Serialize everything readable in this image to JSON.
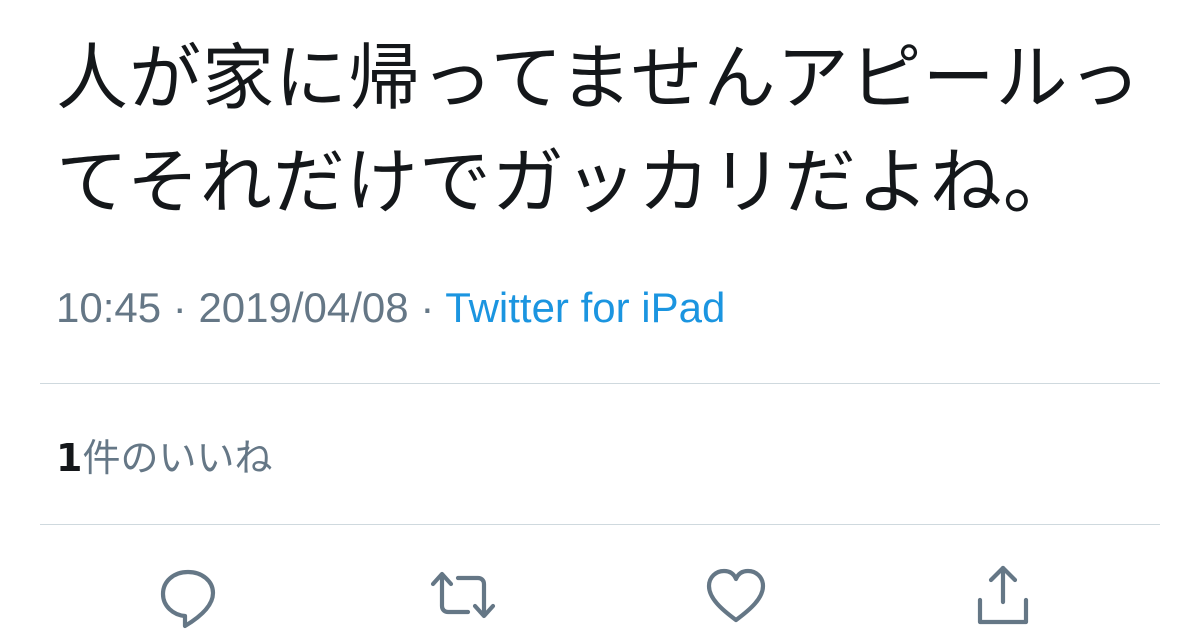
{
  "tweet": {
    "text_lines": [
      "人が家に帰ってませんアピールっ",
      "てそれだけでガッカリだよね。"
    ]
  },
  "meta": {
    "time": "10:45",
    "separator": " · ",
    "date": "2019/04/08",
    "source": "Twitter for iPad"
  },
  "likes": {
    "count": "1",
    "label": "件のいいね"
  },
  "actions": [
    {
      "name": "reply",
      "icon": "reply-icon"
    },
    {
      "name": "retweet",
      "icon": "retweet-icon"
    },
    {
      "name": "like",
      "icon": "heart-icon"
    },
    {
      "name": "share",
      "icon": "share-icon"
    }
  ],
  "colors": {
    "text": "#14171a",
    "muted": "#657786",
    "accent": "#1b95e0",
    "divider": "#cfd9de"
  }
}
